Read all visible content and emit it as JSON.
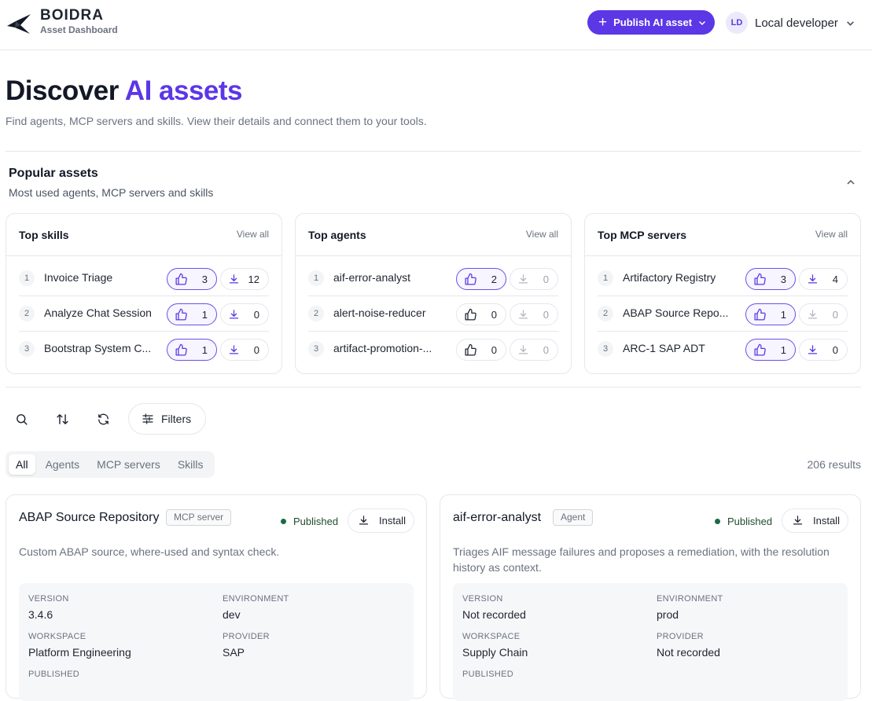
{
  "header": {
    "brand_name": "BOIDRA",
    "brand_sub": "Asset Dashboard",
    "publish_label": "Publish AI asset",
    "user_initials": "LD",
    "user_name": "Local developer"
  },
  "hero": {
    "title_main": "Discover ",
    "title_accent": "AI assets",
    "subtitle": "Find agents, MCP servers and skills. View their details and connect them to your tools."
  },
  "popular": {
    "title": "Popular assets",
    "subtitle": "Most used agents, MCP servers and skills",
    "cards": [
      {
        "title": "Top skills",
        "view_all": "View all",
        "rows": [
          {
            "rank": "1",
            "name": "Invoice Triage",
            "likes": "3",
            "downloads": "12"
          },
          {
            "rank": "2",
            "name": "Analyze Chat Session",
            "likes": "1",
            "downloads": "0"
          },
          {
            "rank": "3",
            "name": "Bootstrap System C...",
            "likes": "1",
            "downloads": "0"
          }
        ]
      },
      {
        "title": "Top agents",
        "view_all": "View all",
        "rows": [
          {
            "rank": "1",
            "name": "aif-error-analyst",
            "likes": "2",
            "downloads": "0"
          },
          {
            "rank": "2",
            "name": "alert-noise-reducer",
            "likes": "0",
            "downloads": "0"
          },
          {
            "rank": "3",
            "name": "artifact-promotion-...",
            "likes": "0",
            "downloads": "0"
          }
        ]
      },
      {
        "title": "Top MCP servers",
        "view_all": "View all",
        "rows": [
          {
            "rank": "1",
            "name": "Artifactory Registry",
            "likes": "3",
            "downloads": "4"
          },
          {
            "rank": "2",
            "name": "ABAP Source Repo...",
            "likes": "1",
            "downloads": "0"
          },
          {
            "rank": "3",
            "name": "ARC-1 SAP ADT",
            "likes": "1",
            "downloads": "0"
          }
        ]
      }
    ]
  },
  "toolbar": {
    "filters_label": "Filters"
  },
  "tabs": {
    "all": "All",
    "agents": "Agents",
    "mcp_servers": "MCP servers",
    "skills": "Skills"
  },
  "results_label": "206 results",
  "assets": [
    {
      "name": "ABAP Source Repository",
      "type": "MCP server",
      "status": "Published",
      "install_label": "Install",
      "description": "Custom ABAP source, where-used and syntax check.",
      "version_label": "VERSION",
      "version": "3.4.6",
      "environment_label": "ENVIRONMENT",
      "environment": "dev",
      "workspace_label": "WORKSPACE",
      "workspace": "Platform Engineering",
      "provider_label": "PROVIDER",
      "provider": "SAP",
      "published_label": "PUBLISHED"
    },
    {
      "name": "aif-error-analyst",
      "type": "Agent",
      "status": "Published",
      "install_label": "Install",
      "description": "Triages AIF message failures and proposes a remediation, with the resolution history as context.",
      "version_label": "VERSION",
      "version": "Not recorded",
      "environment_label": "ENVIRONMENT",
      "environment": "prod",
      "workspace_label": "WORKSPACE",
      "workspace": "Supply Chain",
      "provider_label": "PROVIDER",
      "provider": "Not recorded",
      "published_label": "PUBLISHED"
    }
  ],
  "colors": {
    "accent": "#5b37e6",
    "status_published": "#1b6b46"
  },
  "icons": [
    "logo-bird-icon",
    "plus-icon",
    "chevron-down-icon",
    "chevron-up-icon",
    "thumbs-up-icon",
    "download-icon",
    "search-icon",
    "sort-icon",
    "refresh-icon",
    "filters-icon"
  ]
}
